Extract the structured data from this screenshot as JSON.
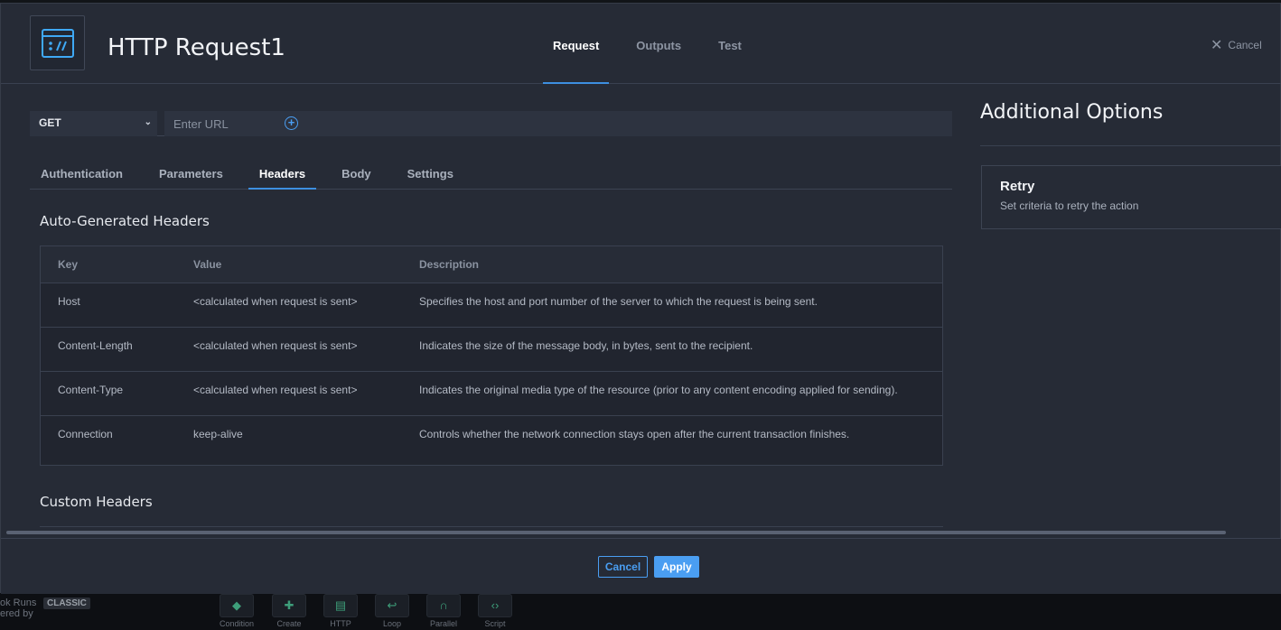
{
  "window": {
    "title": "HTTP Request1",
    "icon": "http-request-icon"
  },
  "top_tabs": [
    {
      "label": "Request",
      "active": true
    },
    {
      "label": "Outputs",
      "active": false
    },
    {
      "label": "Test",
      "active": false
    }
  ],
  "cancel_label": "Cancel",
  "url_bar": {
    "method": "GET",
    "url_value": "",
    "url_placeholder": "Enter URL"
  },
  "sub_tabs": [
    {
      "label": "Authentication",
      "active": false
    },
    {
      "label": "Parameters",
      "active": false
    },
    {
      "label": "Headers",
      "active": true
    },
    {
      "label": "Body",
      "active": false
    },
    {
      "label": "Settings",
      "active": false
    }
  ],
  "auto_headers": {
    "title": "Auto-Generated Headers",
    "columns": [
      "Key",
      "Value",
      "Description"
    ],
    "rows": [
      {
        "key": "Host",
        "value": "<calculated when request is sent>",
        "description": "Specifies the host and port number of the server to which the request is being sent."
      },
      {
        "key": "Content-Length",
        "value": "<calculated when request is sent>",
        "description": "Indicates the size of the message body, in bytes, sent to the recipient."
      },
      {
        "key": "Content-Type",
        "value": "<calculated when request is sent>",
        "description": "Indicates the original media type of the resource (prior to any content encoding applied for sending)."
      },
      {
        "key": "Connection",
        "value": "keep-alive",
        "description": "Controls whether the network connection stays open after the current transaction finishes."
      }
    ]
  },
  "custom_headers": {
    "title": "Custom Headers"
  },
  "additional_options": {
    "title": "Additional Options",
    "retry": {
      "title": "Retry",
      "description": "Set criteria to retry the action"
    }
  },
  "footer": {
    "cancel_label": "Cancel",
    "apply_label": "Apply"
  },
  "background": {
    "status_text": "ok Runs",
    "powered_text": "ered by",
    "classic_badge": "CLASSIC",
    "dock": [
      "Condition",
      "Create",
      "HTTP",
      "Loop",
      "Parallel",
      "Script"
    ]
  },
  "colors": {
    "accent": "#3d8fe0",
    "button": "#4a9ef2",
    "panel": "#262b36"
  }
}
